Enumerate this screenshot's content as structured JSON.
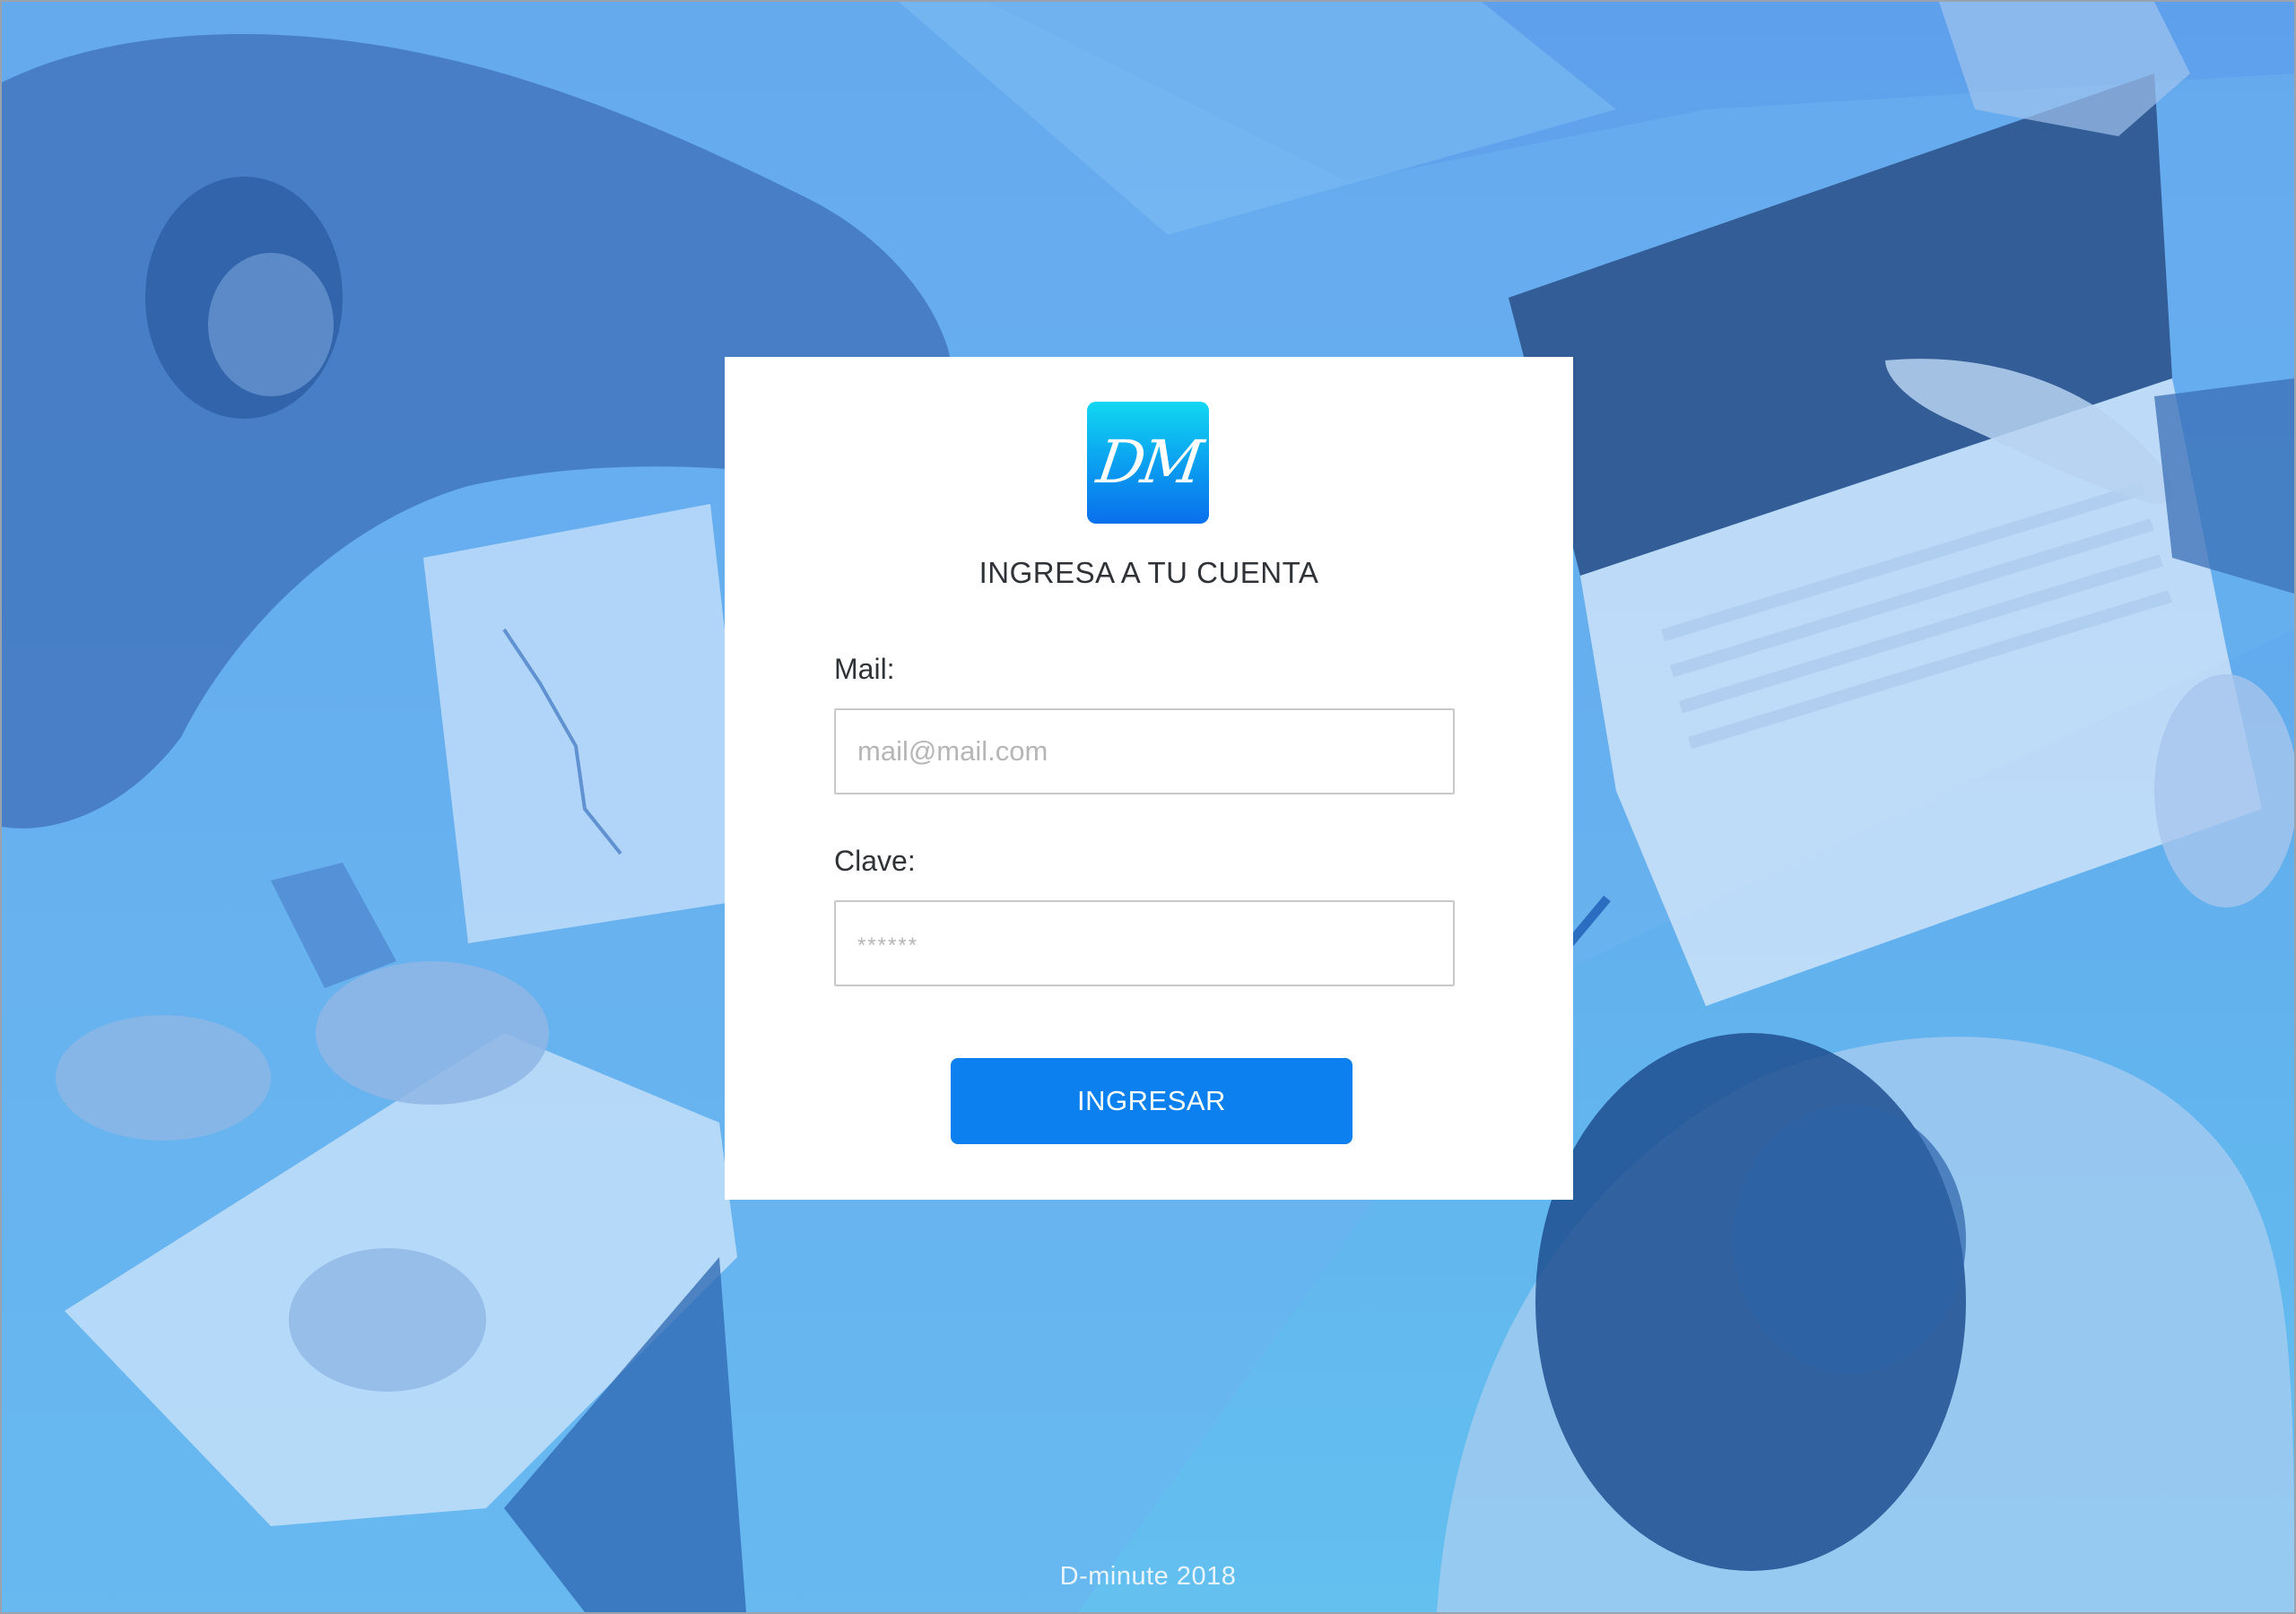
{
  "login": {
    "logo_text": "DM",
    "title": "INGRESA A TU CUENTA",
    "mail_label": "Mail:",
    "mail_placeholder": "mail@mail.com",
    "password_label": "Clave:",
    "password_placeholder": "******",
    "submit_label": "INGRESAR"
  },
  "footer": {
    "text": "D-minute 2018"
  },
  "colors": {
    "background_tint": "#5fa6ee",
    "card_background": "#ffffff",
    "primary_button": "#0b80ee",
    "logo_gradient_top": "#12d8f1",
    "logo_gradient_bottom": "#0a6fec"
  }
}
